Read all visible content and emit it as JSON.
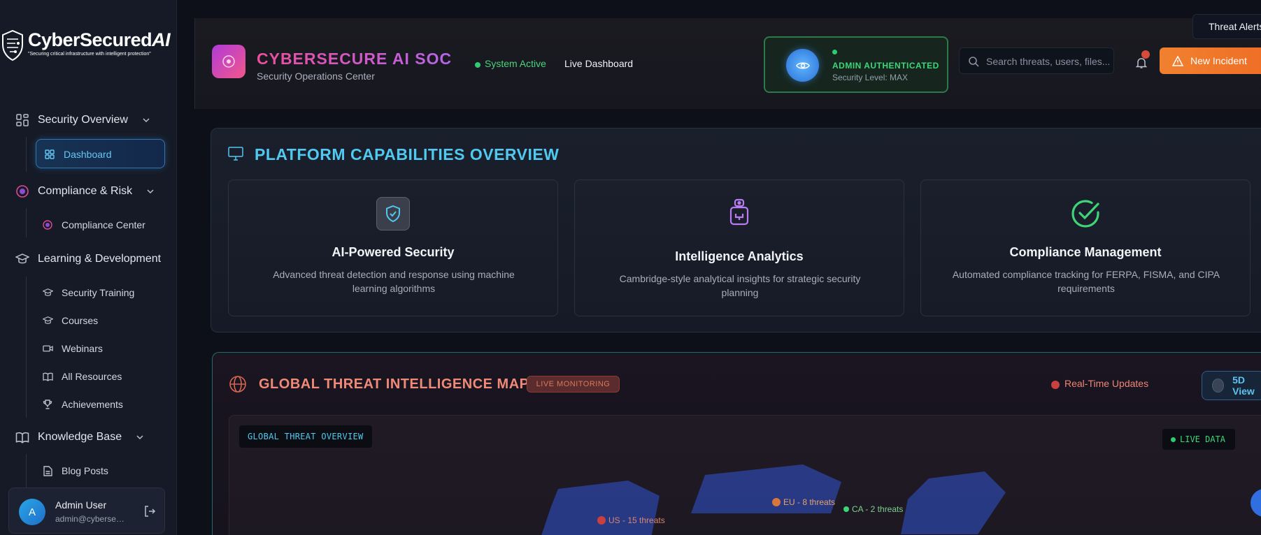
{
  "brand": {
    "logo_name": "CyberSecured",
    "logo_ai": "AI",
    "logo_tagline": "\"Securing critical infrastructure with intelligent protection\""
  },
  "sidebar": {
    "sections": [
      {
        "label": "Security Overview",
        "icon": "grid-icon"
      },
      {
        "label": "Compliance & Risk",
        "icon": "shield-swirl-icon"
      },
      {
        "label": "Learning & Development",
        "icon": "graduation-cap-icon"
      },
      {
        "label": "Knowledge Base",
        "icon": "book-open-icon"
      }
    ],
    "items": {
      "dashboard": "Dashboard",
      "compliance_center": "Compliance Center",
      "security_training": "Security Training",
      "courses": "Courses",
      "webinars": "Webinars",
      "all_resources": "All Resources",
      "achievements": "Achievements",
      "blog_posts": "Blog Posts"
    },
    "user": {
      "initial": "A",
      "name": "Admin User",
      "email": "admin@cybersecured.ai"
    }
  },
  "header": {
    "title": "CYBERSECURE AI SOC",
    "subtitle": "Security Operations Center",
    "status": "System Active",
    "live_dashboard": "Live Dashboard",
    "auth_title": "ADMIN AUTHENTICATED",
    "auth_level": "Security Level: MAX",
    "search_placeholder": "Search threats, users, files...",
    "new_incident": "New Incident",
    "threat_alert": "Threat Alerts"
  },
  "capabilities": {
    "title": "PLATFORM CAPABILITIES OVERVIEW",
    "cards": [
      {
        "title": "AI-Powered Security",
        "desc": "Advanced threat detection and response using machine learning algorithms",
        "icon": "shield-check-icon"
      },
      {
        "title": "Intelligence Analytics",
        "desc": "Cambridge-style analytical insights for strategic security planning",
        "icon": "robot-icon"
      },
      {
        "title": "Compliance Management",
        "desc": "Automated compliance tracking for FERPA, FISMA, and CIPA requirements",
        "icon": "check-circle-icon"
      }
    ]
  },
  "threat_map": {
    "title": "GLOBAL THREAT INTELLIGENCE MAP",
    "badge": "LIVE MONITORING",
    "realtime": "Real-Time Updates",
    "view_toggle": "5D View",
    "overview_tag": "GLOBAL THREAT OVERVIEW",
    "live_data": "LIVE DATA",
    "labels": {
      "us": "US - 15 threats",
      "eu": "EU - 8 threats",
      "ca": "CA - 2 threats"
    }
  },
  "colors": {
    "accent_cyan": "#4fc9ef",
    "accent_orange": "#f0812f",
    "status_green": "#2ecc71",
    "threat_red": "#c9403e"
  }
}
